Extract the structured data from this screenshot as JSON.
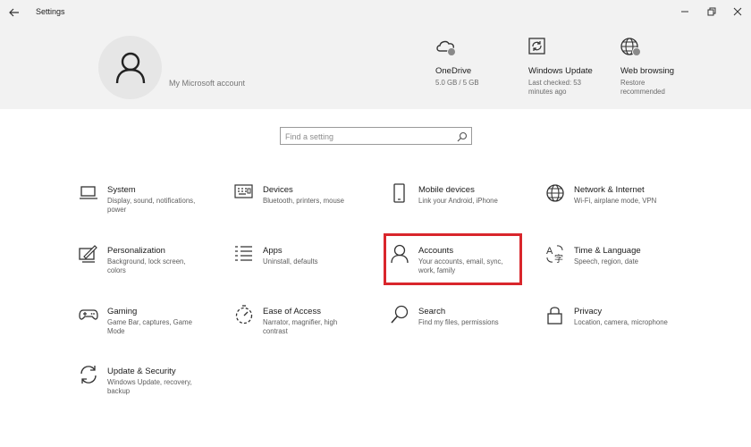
{
  "window": {
    "title": "Settings"
  },
  "header": {
    "account_link": "My Microsoft account",
    "cards": [
      {
        "id": "onedrive",
        "title": "OneDrive",
        "subtitle": "5.0 GB / 5 GB",
        "icon": "cloud-icon"
      },
      {
        "id": "windows-update",
        "title": "Windows Update",
        "subtitle": "Last checked: 53 minutes ago",
        "icon": "refresh-icon"
      },
      {
        "id": "web-browsing",
        "title": "Web browsing",
        "subtitle": "Restore recommended",
        "icon": "globe-icon"
      }
    ]
  },
  "search": {
    "placeholder": "Find a setting"
  },
  "categories": [
    {
      "title": "System",
      "description": "Display, sound, notifications, power",
      "icon": "laptop-icon"
    },
    {
      "title": "Devices",
      "description": "Bluetooth, printers, mouse",
      "icon": "keyboard-icon"
    },
    {
      "title": "Mobile devices",
      "description": "Link your Android, iPhone",
      "icon": "phone-icon"
    },
    {
      "title": "Network & Internet",
      "description": "Wi-Fi, airplane mode, VPN",
      "icon": "globe-icon"
    },
    {
      "title": "Personalization",
      "description": "Background, lock screen, colors",
      "icon": "paint-icon"
    },
    {
      "title": "Apps",
      "description": "Uninstall, defaults",
      "icon": "list-icon"
    },
    {
      "title": "Accounts",
      "description": "Your accounts, email, sync, work, family",
      "icon": "person-icon"
    },
    {
      "title": "Time & Language",
      "description": "Speech, region, date",
      "icon": "language-icon"
    },
    {
      "title": "Gaming",
      "description": "Game Bar, captures, Game Mode",
      "icon": "gamepad-icon"
    },
    {
      "title": "Ease of Access",
      "description": "Narrator, magnifier, high contrast",
      "icon": "timer-icon"
    },
    {
      "title": "Search",
      "description": "Find my files, permissions",
      "icon": "search-icon"
    },
    {
      "title": "Privacy",
      "description": "Location, camera, microphone",
      "icon": "lock-icon"
    },
    {
      "title": "Update & Security",
      "description": "Windows Update, recovery, backup",
      "icon": "sync-icon"
    }
  ],
  "colors": {
    "header_background": "#f2f2f2",
    "highlight_border": "#d9262c"
  }
}
